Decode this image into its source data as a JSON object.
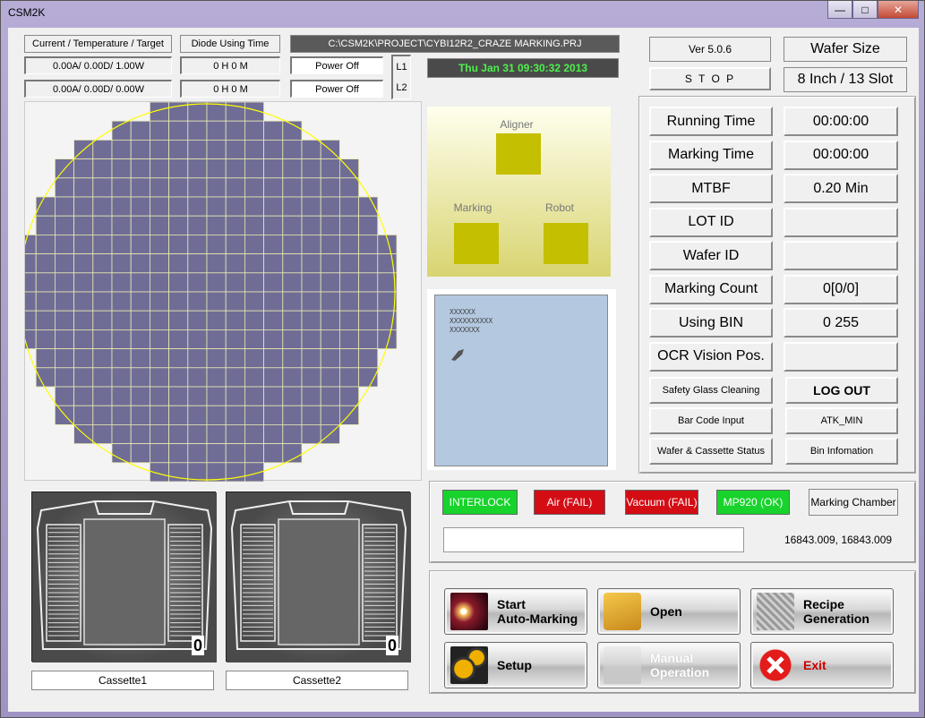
{
  "window": {
    "title": "CSM2K",
    "minimize": "—",
    "maximize": "□",
    "close": "✕"
  },
  "header": {
    "ctt_label": "Current / Temperature / Target",
    "ctt_row1": "0.00A/  0.00D/  1.00W",
    "ctt_row2": "0.00A/  0.00D/  0.00W",
    "diode_label": "Diode Using Time",
    "diode_row1": "0 H 0 M",
    "diode_row2": "0 H 0 M",
    "power_row1": "Power Off",
    "power_row2": "Power Off",
    "l1": "L1",
    "l2": "L2",
    "project_path": "C:\\CSM2K\\PROJECT\\CYBI12R2_CRAZE MARKING.PRJ",
    "datetime": "Thu Jan 31 09:30:32 2013"
  },
  "version": "Ver 5.0.6",
  "stop_button": "S T O P",
  "wafer_size_label": "Wafer Size",
  "wafer_size_value": "8 Inch / 13 Slot",
  "info_rows": [
    {
      "label": "Running Time",
      "value": "00:00:00"
    },
    {
      "label": "Marking Time",
      "value": "00:00:00"
    },
    {
      "label": "MTBF",
      "value": "0.20 Min"
    },
    {
      "label": "LOT ID",
      "value": ""
    },
    {
      "label": "Wafer ID",
      "value": ""
    },
    {
      "label": "Marking Count",
      "value": "0[0/0]"
    },
    {
      "label": "Using BIN",
      "value": "0 255"
    },
    {
      "label": "OCR Vision Pos.",
      "value": ""
    }
  ],
  "side_buttons": [
    {
      "label": "Safety Glass Cleaning"
    },
    {
      "label": "LOG OUT"
    },
    {
      "label": "Bar Code Input"
    },
    {
      "label": "ATK_MIN"
    },
    {
      "label": "Wafer & Cassette Status"
    },
    {
      "label": "Bin Infomation"
    }
  ],
  "stations": {
    "aligner": "Aligner",
    "marking": "Marking",
    "robot": "Robot",
    "color": "#c4bf00"
  },
  "preview_text": [
    "XXXXXX",
    "XXXXXXXXXX",
    "XXXXXXX"
  ],
  "status_lamps": [
    {
      "label": "INTERLOCK",
      "state": "ok"
    },
    {
      "label": "Air (FAIL)",
      "state": "fail"
    },
    {
      "label": "Vacuum (FAIL)",
      "state": "fail"
    },
    {
      "label": "MP920 (OK)",
      "state": "ok"
    }
  ],
  "marking_chamber": "Marking Chamber",
  "message_input": "",
  "coordinates": "16843.009, 16843.009",
  "action_buttons": [
    {
      "label": "Start\nAuto-Marking",
      "icon": "laser-icon"
    },
    {
      "label": "Open",
      "icon": "folder-icon"
    },
    {
      "label": "Recipe\nGeneration",
      "icon": "recipe-icon"
    },
    {
      "label": "Setup",
      "icon": "gears-icon"
    },
    {
      "label": "Manual\nOperation",
      "icon": "robot-arm-icon"
    },
    {
      "label": "Exit",
      "icon": "exit-icon"
    }
  ],
  "cassettes": [
    {
      "label": "Cassette1",
      "count": "0"
    },
    {
      "label": "Cassette2",
      "count": "0"
    }
  ],
  "wafer_map": {
    "die_color": "#6f6d96",
    "grid_color": "#e8e8b0",
    "circle_color": "#ffff00"
  }
}
